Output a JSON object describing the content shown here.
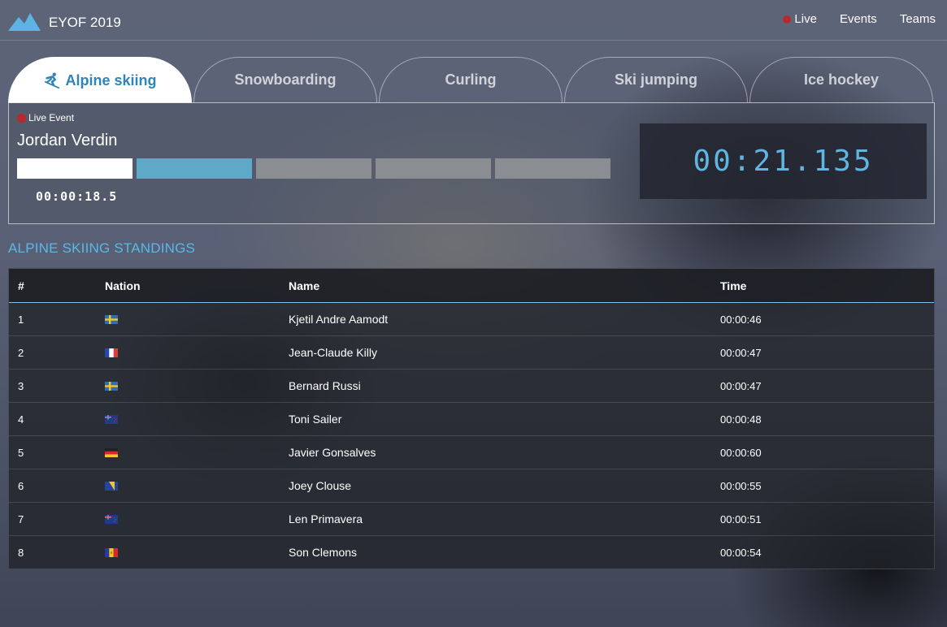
{
  "app": {
    "brand": "EYOF 2019",
    "nav": [
      {
        "label": "Live",
        "live": true
      },
      {
        "label": "Events"
      },
      {
        "label": "Teams"
      }
    ]
  },
  "tabs": [
    {
      "label": "Alpine skiing",
      "active": true,
      "icon": "skier-icon"
    },
    {
      "label": "Snowboarding"
    },
    {
      "label": "Curling"
    },
    {
      "label": "Ski jumping"
    },
    {
      "label": "Ice hockey"
    }
  ],
  "live_event": {
    "badge": "Live Event",
    "athlete": "Jordan Verdin",
    "segments": [
      "complete",
      "current",
      "pending",
      "pending",
      "pending"
    ],
    "elapsed": "00:00:18.5",
    "clock": "00:21.135"
  },
  "standings": {
    "title": "ALPINE SKIING STANDINGS",
    "columns": [
      "#",
      "Nation",
      "Name",
      "Time"
    ],
    "rows": [
      {
        "rank": "1",
        "nation": "sweden-flag",
        "name": "Kjetil Andre Aamodt",
        "time": "00:00:46"
      },
      {
        "rank": "2",
        "nation": "france-flag",
        "name": "Jean-Claude Killy",
        "time": "00:00:47"
      },
      {
        "rank": "3",
        "nation": "sweden-flag",
        "name": "Bernard Russi",
        "time": "00:00:47"
      },
      {
        "rank": "4",
        "nation": "new-zealand-flag",
        "name": "Toni Sailer",
        "time": "00:00:48"
      },
      {
        "rank": "5",
        "nation": "germany-flag",
        "name": "Javier Gonsalves",
        "time": "00:00:60"
      },
      {
        "rank": "6",
        "nation": "bosnia-flag",
        "name": "Joey Clouse",
        "time": "00:00:55"
      },
      {
        "rank": "7",
        "nation": "new-zealand-flag",
        "name": "Len Primavera",
        "time": "00:00:51"
      },
      {
        "rank": "8",
        "nation": "andorra-flag",
        "name": "Son Clemons",
        "time": "00:00:54"
      }
    ]
  },
  "colors": {
    "accent": "#59b8e6",
    "clock": "#5fb6e0",
    "live": "#b8282c",
    "tab_active_text": "#2f84b8",
    "segment_complete": "#ffffff",
    "segment_current": "#5ea8c8",
    "segment_pending": "#8a8d92"
  }
}
